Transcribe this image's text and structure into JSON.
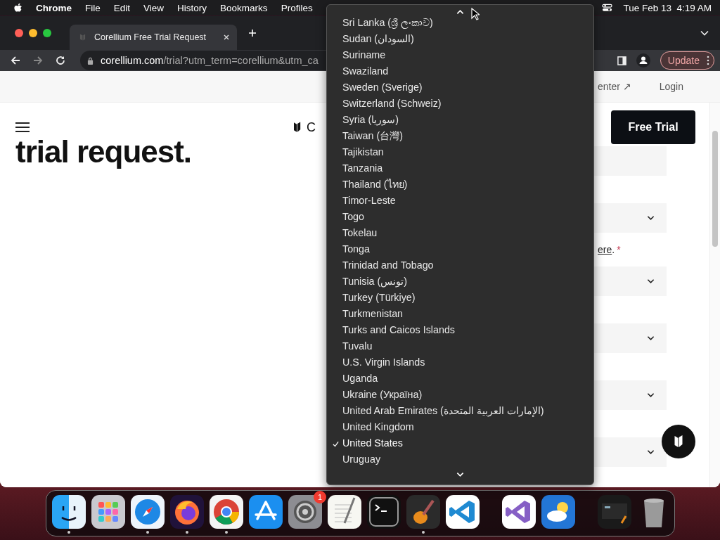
{
  "menu_bar": {
    "app": "Chrome",
    "items": [
      "File",
      "Edit",
      "View",
      "History",
      "Bookmarks",
      "Profiles"
    ],
    "clock": "Tue Feb 13  4:19 AM"
  },
  "browser": {
    "tab_title": "Corellium Free Trial Request",
    "url_host": "corellium.com",
    "url_path": "/trial?utm_term=corellium&utm_ca",
    "update_label": "Update"
  },
  "page": {
    "nav_links": [
      "enter ↗",
      "Login"
    ],
    "heading": "trial request.",
    "logo_text": "C",
    "cta": "Free Trial",
    "consent_link": "ere",
    "consent_tail": ".",
    "required_mark": "*",
    "fields": [
      {
        "kind": "text"
      },
      {
        "kind": "select"
      },
      {
        "kind": "consent"
      },
      {
        "kind": "select"
      },
      {
        "kind": "select"
      },
      {
        "kind": "select"
      },
      {
        "kind": "select"
      }
    ]
  },
  "dropdown": {
    "items": [
      {
        "label": "Sri Lanka (ශ්‍රී ලංකාව)",
        "selected": false
      },
      {
        "label": "Sudan (السودان)",
        "selected": false
      },
      {
        "label": "Suriname",
        "selected": false
      },
      {
        "label": "Swaziland",
        "selected": false
      },
      {
        "label": "Sweden (Sverige)",
        "selected": false
      },
      {
        "label": "Switzerland (Schweiz)",
        "selected": false
      },
      {
        "label": "Syria (سوريا)",
        "selected": false
      },
      {
        "label": "Taiwan (台灣)",
        "selected": false
      },
      {
        "label": "Tajikistan",
        "selected": false
      },
      {
        "label": "Tanzania",
        "selected": false
      },
      {
        "label": "Thailand (ไทย)",
        "selected": false
      },
      {
        "label": "Timor-Leste",
        "selected": false
      },
      {
        "label": "Togo",
        "selected": false
      },
      {
        "label": "Tokelau",
        "selected": false
      },
      {
        "label": "Tonga",
        "selected": false
      },
      {
        "label": "Trinidad and Tobago",
        "selected": false
      },
      {
        "label": "Tunisia (تونس)",
        "selected": false
      },
      {
        "label": "Turkey (Türkiye)",
        "selected": false
      },
      {
        "label": "Turkmenistan",
        "selected": false
      },
      {
        "label": "Turks and Caicos Islands",
        "selected": false
      },
      {
        "label": "Tuvalu",
        "selected": false
      },
      {
        "label": "U.S. Virgin Islands",
        "selected": false
      },
      {
        "label": "Uganda",
        "selected": false
      },
      {
        "label": "Ukraine (Україна)",
        "selected": false
      },
      {
        "label": "United Arab Emirates (الإمارات العربية المتحدة)",
        "selected": false
      },
      {
        "label": "United Kingdom",
        "selected": false
      },
      {
        "label": "United States",
        "selected": true
      },
      {
        "label": "Uruguay",
        "selected": false
      }
    ]
  },
  "dock": {
    "items": [
      {
        "kind": "finder",
        "running": true
      },
      {
        "kind": "launchpad",
        "running": false
      },
      {
        "kind": "safari",
        "running": true
      },
      {
        "kind": "firefox",
        "running": true
      },
      {
        "kind": "chrome",
        "running": true
      },
      {
        "kind": "appstore",
        "running": false
      },
      {
        "kind": "settings",
        "running": false,
        "badge": "1"
      },
      {
        "kind": "textedit",
        "running": false
      },
      {
        "kind": "terminal",
        "running": false
      },
      {
        "kind": "garageband",
        "running": true
      },
      {
        "kind": "vscode",
        "running": false
      },
      {
        "kind": "separator"
      },
      {
        "kind": "visualstudio",
        "running": false
      },
      {
        "kind": "weather",
        "running": false
      },
      {
        "kind": "separator"
      },
      {
        "kind": "window",
        "running": false
      },
      {
        "kind": "trash",
        "running": false
      }
    ]
  }
}
